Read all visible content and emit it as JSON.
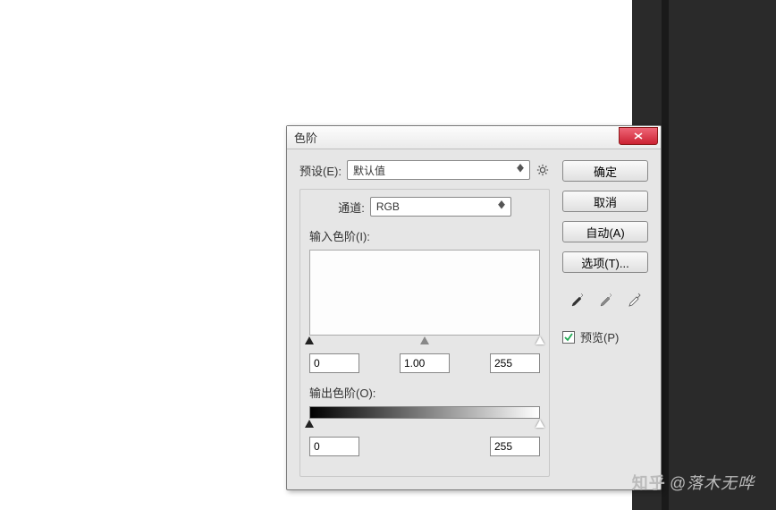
{
  "dialog": {
    "title": "色阶",
    "preset_label": "预设(E):",
    "preset_value": "默认值",
    "channel_label": "通道:",
    "channel_value": "RGB",
    "input_levels_label": "输入色阶(I):",
    "input_black": "0",
    "input_gamma": "1.00",
    "input_white": "255",
    "output_levels_label": "输出色阶(O):",
    "output_black": "0",
    "output_white": "255"
  },
  "buttons": {
    "ok": "确定",
    "cancel": "取消",
    "auto": "自动(A)",
    "options": "选项(T)..."
  },
  "preview": {
    "label": "预览(P)",
    "checked": true
  },
  "watermark": {
    "site": "知乎",
    "user": "@落木无哗"
  }
}
